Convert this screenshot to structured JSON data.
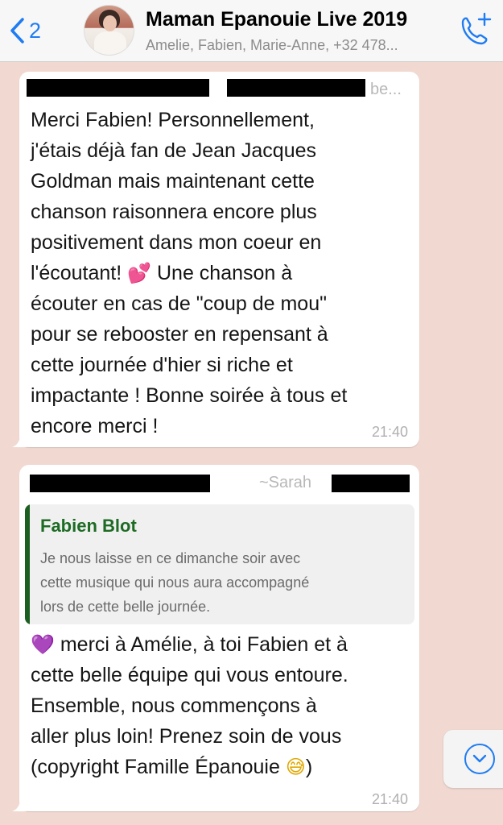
{
  "header": {
    "back_count": "2",
    "title": "Maman Epanouie Live 2019",
    "subtitle": "Amelie, Fabien, Marie-Anne, +32 478...",
    "icons": {
      "back": "chevron-left-icon",
      "call": "add-call-icon"
    },
    "accent_color": "#1f7cf2"
  },
  "messages": [
    {
      "sender_suffix": "be...",
      "lines": [
        "Merci Fabien! Personnellement,",
        "j'étais déjà fan de Jean Jacques",
        "Goldman mais maintenant cette",
        "chanson raisonnera encore plus",
        "positivement dans mon coeur en",
        "l'écoutant!",
        "Une chanson à",
        "écouter en cas de \"coup de mou\"",
        "pour se rebooster en repensant à",
        "cette journée d'hier si riche et",
        "impactante ! Bonne soirée à tous et",
        "encore merci !"
      ],
      "emoji_hearts": "💕",
      "time": "21:40"
    },
    {
      "sender_name": "~Sarah",
      "quote": {
        "name": "Fabien Blot",
        "lines": [
          "Je nous laisse en ce dimanche soir avec",
          "cette musique qui nous aura accompagné",
          "lors de cette belle journée."
        ]
      },
      "emoji_heart": "💜",
      "lines": [
        "merci à Amélie, à toi Fabien et à",
        "cette belle équipe qui vous entoure.",
        "Ensemble, nous commençons à",
        "aller plus loin! Prenez soin de vous",
        "(copyright Famille Épanouie",
        ")"
      ],
      "emoji_sweat": "😅",
      "time": "21:40"
    }
  ],
  "scroll_button": {
    "icon": "chevron-down-circle-icon"
  },
  "colors": {
    "background": "#f1d9d2",
    "quote_bar": "#1b5e20",
    "quote_name": "#1d6b24"
  }
}
